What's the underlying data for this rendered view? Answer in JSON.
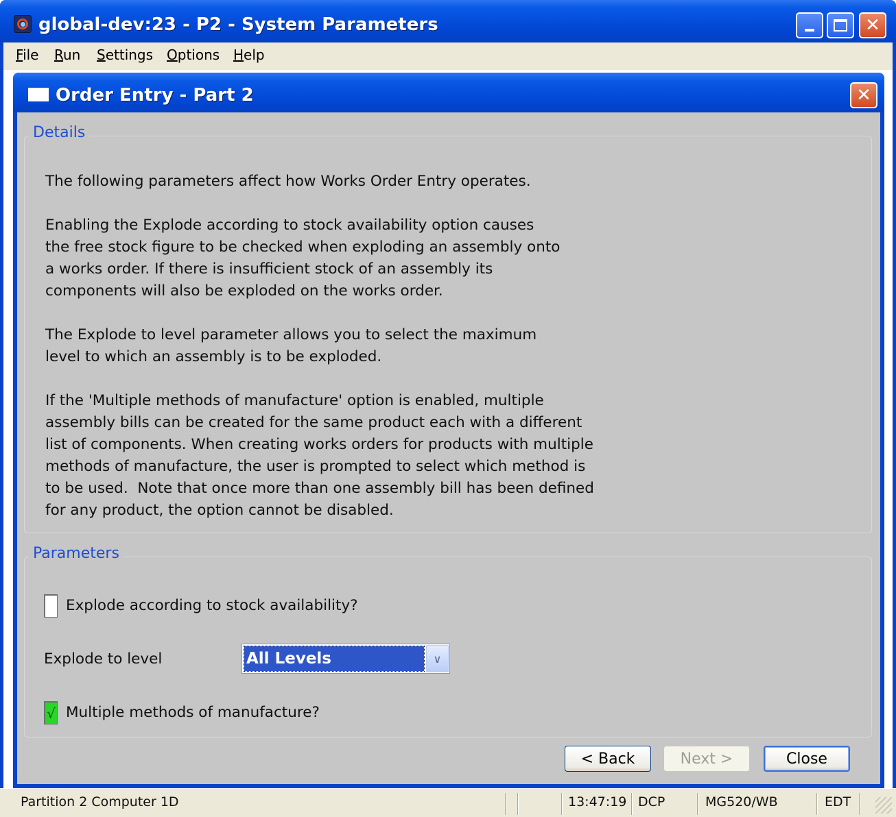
{
  "window": {
    "title": "global-dev:23 - P2 - System Parameters"
  },
  "menu": [
    {
      "label": "File",
      "mnemonic": "F",
      "rest": "ile"
    },
    {
      "label": "Run",
      "mnemonic": "R",
      "rest": "un"
    },
    {
      "label": "Settings",
      "mnemonic": "S",
      "rest": "ettings"
    },
    {
      "label": "Options",
      "mnemonic": "O",
      "rest": "ptions"
    },
    {
      "label": "Help",
      "mnemonic": "H",
      "rest": "elp"
    }
  ],
  "dialog": {
    "title": "Order Entry - Part 2",
    "details": {
      "label": "Details",
      "paragraphs": [
        "The following parameters affect how Works Order Entry operates.",
        "Enabling the Explode according to stock availability option causes\nthe free stock figure to be checked when exploding an assembly onto\na works order. If there is insufficient stock of an assembly its\ncomponents will also be exploded on the works order.",
        "The Explode to level parameter allows you to select the maximum\nlevel to which an assembly is to be exploded.",
        "If the 'Multiple methods of manufacture' option is enabled, multiple\nassembly bills can be created for the same product each with a different\nlist of components. When creating works orders for products with multiple\nmethods of manufacture, the user is prompted to select which method is\nto be used.  Note that once more than one assembly bill has been defined\nfor any product, the option cannot be disabled."
      ]
    },
    "parameters": {
      "label": "Parameters",
      "explode_stock": {
        "label": "Explode according to stock availability?",
        "checked": false
      },
      "explode_level": {
        "label": "Explode to level",
        "value": "All Levels"
      },
      "multiple_methods": {
        "label": "Multiple methods of manufacture?",
        "checked": true,
        "mark": "√"
      }
    },
    "buttons": {
      "back": "< Back",
      "next": "Next >",
      "close": "Close"
    }
  },
  "status_bar": {
    "partition": "Partition 2 Computer 1D",
    "time": "13:47:19",
    "mode": "DCP",
    "company": "MG520/WB",
    "edit": "EDT"
  },
  "colors": {
    "title_bar": "#0349d8",
    "dialog_body": "#c6c6c6",
    "group_label": "#1f4fcf",
    "check_on": "#28d628",
    "combo_selected": "#2f56c9"
  }
}
